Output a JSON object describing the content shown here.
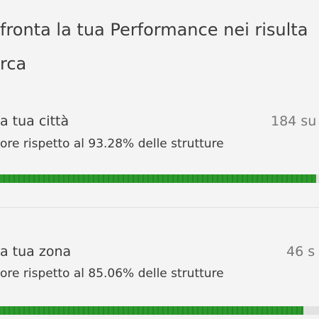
{
  "header": {
    "title": "fronta la tua Performance nei risulta",
    "subtitle": "rca"
  },
  "rows": [
    {
      "title": "a tua città",
      "rank": "184 su",
      "description": "ore rispetto al 93.28% delle strutture",
      "progress": 0.99
    },
    {
      "title": "a tua zona",
      "rank": "46 s",
      "description": "ore rispetto al 85.06% delle strutture",
      "progress": 0.95
    }
  ],
  "colors": {
    "bar_fill": "#2d9a2d",
    "bar_track": "#e2e2e2",
    "background": "#f4f4f4"
  }
}
